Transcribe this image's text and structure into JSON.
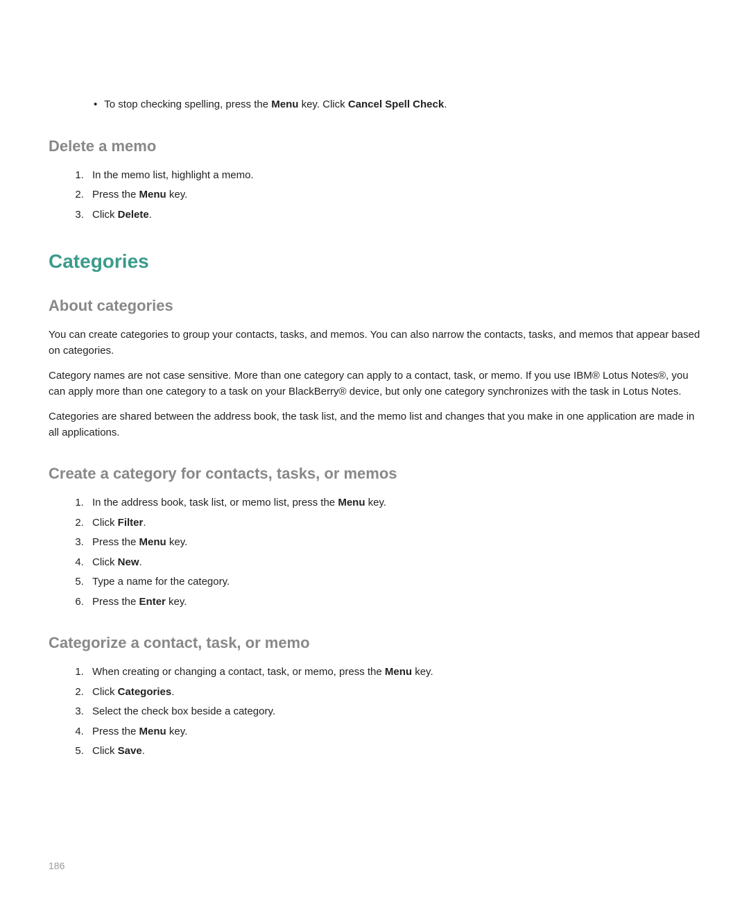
{
  "top_bullet": {
    "prefix": "To stop checking spelling, press the ",
    "bold1": "Menu",
    "mid": " key. Click ",
    "bold2": "Cancel Spell Check",
    "suffix": "."
  },
  "delete_memo": {
    "heading": "Delete a memo",
    "items": [
      {
        "text": "In the memo list, highlight a memo."
      },
      {
        "prefix": "Press the ",
        "bold": "Menu",
        "suffix": " key."
      },
      {
        "prefix": "Click ",
        "bold": "Delete",
        "suffix": "."
      }
    ]
  },
  "categories_heading": "Categories",
  "about_categories": {
    "heading": "About categories",
    "p1": "You can create categories to group your contacts, tasks, and memos. You can also narrow the contacts, tasks, and memos that appear based on categories.",
    "p2": "Category names are not case sensitive. More than one category can apply to a contact, task, or memo. If you use IBM® Lotus Notes®, you can apply more than one category to a task on your BlackBerry® device, but only one category synchronizes with the task in Lotus Notes.",
    "p3": "Categories are shared between the address book, the task list, and the memo list and changes that you make in one application are made in all applications."
  },
  "create_category": {
    "heading": "Create a category for contacts, tasks, or memos",
    "items": [
      {
        "prefix": "In the address book, task list, or memo list, press the ",
        "bold": "Menu",
        "suffix": " key."
      },
      {
        "prefix": "Click ",
        "bold": "Filter",
        "suffix": "."
      },
      {
        "prefix": "Press the ",
        "bold": "Menu",
        "suffix": " key."
      },
      {
        "prefix": "Click ",
        "bold": "New",
        "suffix": "."
      },
      {
        "text": "Type a name for the category."
      },
      {
        "prefix": "Press the ",
        "bold": "Enter",
        "suffix": " key."
      }
    ]
  },
  "categorize": {
    "heading": "Categorize a contact, task, or memo",
    "items": [
      {
        "prefix": "When creating or changing a contact, task, or memo, press the ",
        "bold": "Menu",
        "suffix": " key."
      },
      {
        "prefix": "Click ",
        "bold": "Categories",
        "suffix": "."
      },
      {
        "text": "Select the check box beside a category."
      },
      {
        "prefix": "Press the ",
        "bold": "Menu",
        "suffix": " key."
      },
      {
        "prefix": "Click ",
        "bold": "Save",
        "suffix": "."
      }
    ]
  },
  "page_number": "186"
}
